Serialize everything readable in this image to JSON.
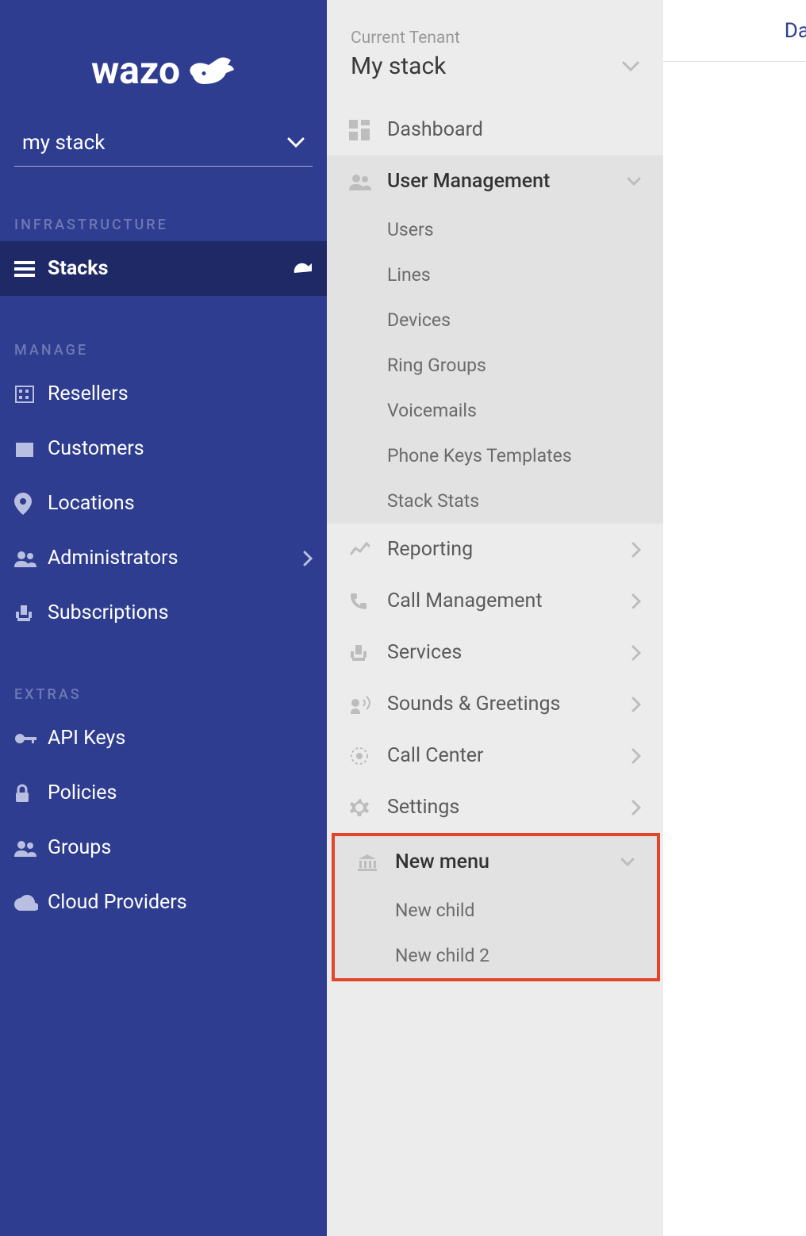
{
  "brand": {
    "name": "wazo"
  },
  "stack_selector": {
    "value": "my stack"
  },
  "left": {
    "sections": {
      "infra": {
        "title": "INFRASTRUCTURE",
        "stacks": "Stacks"
      },
      "manage": {
        "title": "MANAGE",
        "resellers": "Resellers",
        "customers": "Customers",
        "locations": "Locations",
        "administrators": "Administrators",
        "subscriptions": "Subscriptions"
      },
      "extras": {
        "title": "EXTRAS",
        "api_keys": "API Keys",
        "policies": "Policies",
        "groups": "Groups",
        "cloud_providers": "Cloud Providers"
      }
    }
  },
  "right": {
    "tenant_label": "Current Tenant",
    "tenant_value": "My stack",
    "dashboard": "Dashboard",
    "user_mgmt": {
      "label": "User Management",
      "users": "Users",
      "lines": "Lines",
      "devices": "Devices",
      "ring_groups": "Ring Groups",
      "voicemails": "Voicemails",
      "phone_keys": "Phone Keys Templates",
      "stack_stats": "Stack Stats"
    },
    "reporting": "Reporting",
    "call_mgmt": "Call Management",
    "services": "Services",
    "sounds": "Sounds & Greetings",
    "call_center": "Call Center",
    "settings": "Settings",
    "new_menu": {
      "label": "New menu",
      "child1": "New child",
      "child2": "New child 2"
    }
  },
  "content": {
    "breadcrumb_fragment": "Da"
  }
}
